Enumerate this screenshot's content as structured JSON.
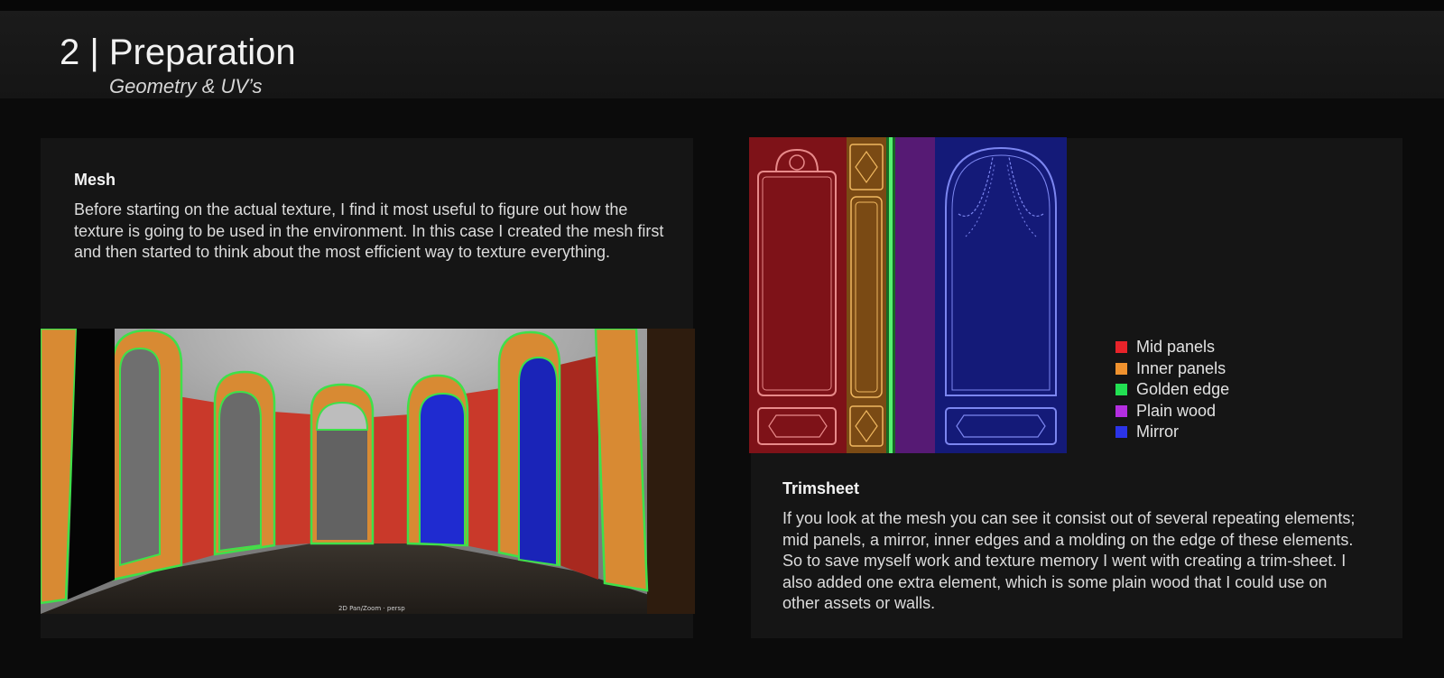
{
  "header": {
    "title": "2 | Preparation",
    "subtitle": "Geometry & UV’s"
  },
  "mesh_section": {
    "heading": "Mesh",
    "body": "Before starting on the actual texture, I find it most useful to figure out how the texture is going to be used in the environment. In this case I created the mesh first and then started to think about the most efficient way to texture everything.",
    "render_caption": "2D Pan/Zoom · persp"
  },
  "trimsheet_section": {
    "heading": "Trimsheet",
    "body": "If you look at the mesh you can see it consist out of several repeating elements; mid panels, a mirror, inner edges and a molding on the edge of these elements. So to save myself work and texture memory I went with creating a trim-sheet. I also added one extra element, which is some plain wood that I could use on other assets or walls."
  },
  "legend": [
    {
      "label": "Mid panels",
      "color": "#e8232a"
    },
    {
      "label": "Inner panels",
      "color": "#f0922e"
    },
    {
      "label": "Golden edge",
      "color": "#22e052"
    },
    {
      "label": "Plain wood",
      "color": "#b42ee0"
    },
    {
      "label": "Mirror",
      "color": "#2b34e8"
    }
  ]
}
